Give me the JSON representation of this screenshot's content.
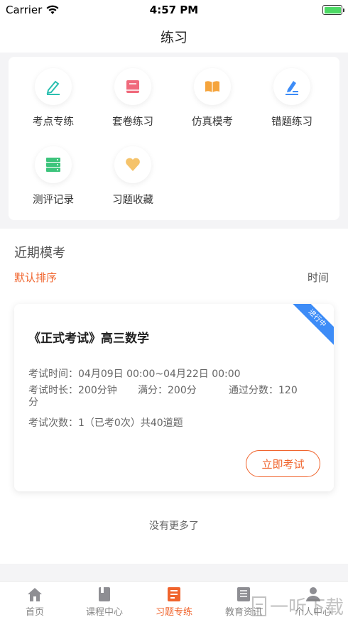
{
  "status": {
    "carrier": "Carrier",
    "time": "4:57 PM"
  },
  "header": {
    "title": "练习"
  },
  "grid": [
    {
      "label": "考点专练",
      "icon": "pen-icon",
      "color": "#2bbfb0"
    },
    {
      "label": "套卷练习",
      "icon": "book-icon",
      "color": "#f06a7c"
    },
    {
      "label": "仿真模考",
      "icon": "open-book-icon",
      "color": "#f5a43c"
    },
    {
      "label": "错题练习",
      "icon": "edit-icon",
      "color": "#3d8cf7"
    },
    {
      "label": "测评记录",
      "icon": "list-icon",
      "color": "#3cc47c"
    },
    {
      "label": "习题收藏",
      "icon": "heart-icon",
      "color": "#f5c36b"
    }
  ],
  "section": {
    "title": "近期模考",
    "sort_default": "默认排序",
    "sort_time": "时间"
  },
  "exam": {
    "ribbon": "进行中",
    "title": "《正式考试》高三数学",
    "time_label": "考试时间：",
    "time_value": "04月09日 00:00~04月22日 00:00",
    "duration_label": "考试时长：",
    "duration_value": "200分钟",
    "full_label": "满分：",
    "full_value": "200分",
    "pass_label": "通过分数：",
    "pass_value": "120",
    "pass_unit": "分",
    "count_label": "考试次数：",
    "count_value": "1（已考0次）共40道题",
    "button": "立即考试"
  },
  "footer": {
    "no_more": "没有更多了"
  },
  "tabs": [
    {
      "label": "首页",
      "icon": "home-icon"
    },
    {
      "label": "课程中心",
      "icon": "course-icon"
    },
    {
      "label": "习题专练",
      "icon": "exercise-icon",
      "active": true
    },
    {
      "label": "教育资讯",
      "icon": "news-icon"
    },
    {
      "label": "个人中心",
      "icon": "person-icon"
    }
  ],
  "watermark": "一听下载",
  "colors": {
    "accent": "#f0642d",
    "ribbon": "#3d8cf7"
  }
}
